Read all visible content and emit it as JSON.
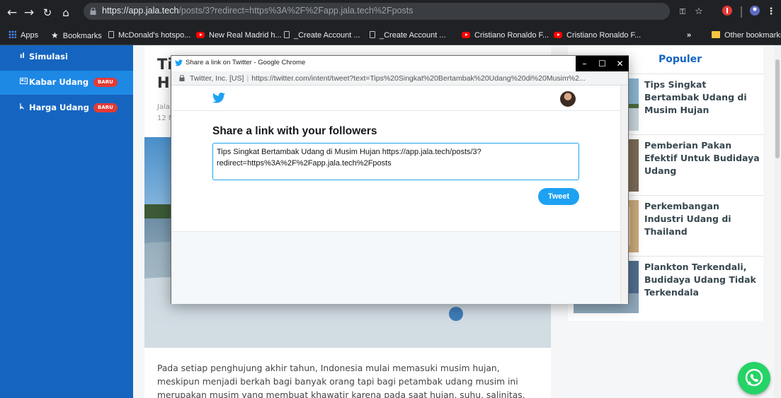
{
  "browser": {
    "url_host": "https://app.jala.tech",
    "url_path": "/posts/3?redirect=https%3A%2F%2Fapp.jala.tech%2Fposts",
    "bookmarks": [
      {
        "label": "Apps",
        "icon": "apps-icon"
      },
      {
        "label": "Bookmarks",
        "icon": "star-icon"
      },
      {
        "label": "McDonald's hotspo...",
        "icon": "page-icon"
      },
      {
        "label": "New Real Madrid h...",
        "icon": "youtube-icon"
      },
      {
        "label": "_Create Account ...",
        "icon": "page-icon"
      },
      {
        "label": "_Create Account ...",
        "icon": "page-icon"
      },
      {
        "label": "Cristiano Ronaldo F...",
        "icon": "youtube-icon"
      },
      {
        "label": "Cristiano Ronaldo F...",
        "icon": "youtube-icon"
      }
    ],
    "more_label": "»",
    "other_bookmarks": "Other bookmarks"
  },
  "sidebar": {
    "items": [
      {
        "label": "Simulasi",
        "icon": "chart-icon",
        "badge": "",
        "active": false
      },
      {
        "label": "Kabar Udang",
        "icon": "news-icon",
        "badge": "BARU",
        "active": true
      },
      {
        "label": "Harga Udang",
        "icon": "shrimp-icon",
        "badge": "BARU",
        "active": false
      }
    ]
  },
  "article": {
    "title_fragment": "Ti\nH",
    "meta_fragment": "Jala\n12 N",
    "body": "Pada setiap penghujung akhir tahun, Indonesia mulai memasuki musim hujan, meskipun menjadi berkah bagi banyak orang tapi bagi petambak udang musim ini merupakan musim yang membuat khawatir karena pada saat hujan, suhu, salinitas, pH dan oksigen terlarut (DO)"
  },
  "populer": {
    "heading": "Populer",
    "items": [
      {
        "title": "Tips Singkat Bertambak Udang di Musim Hujan"
      },
      {
        "title": "Pemberian Pakan Efektif Untuk Budidaya Udang"
      },
      {
        "title": "Perkembangan Industri Udang di Thailand"
      },
      {
        "title": "Plankton Terkendali, Budidaya Udang Tidak Terkendala"
      }
    ]
  },
  "popup": {
    "window_title": "Share a link on Twitter - Google Chrome",
    "site_identity": "Twitter, Inc. [US]",
    "url": "https://twitter.com/intent/tweet?text=Tips%20Singkat%20Bertambak%20Udang%20di%20Musim%2...",
    "heading": "Share a link with your followers",
    "tweet_text": "Tips Singkat Bertambak Udang di Musim Hujan https://app.jala.tech/posts/3?\nredirect=https%3A%2F%2Fapp.jala.tech%2Fposts",
    "tweet_button": "Tweet",
    "win_minimize": "–",
    "win_maximize": "☐",
    "win_close": "✕"
  },
  "colors": {
    "sidebar": "#1565c0",
    "sidebar_active": "#1e88e5",
    "badge": "#e53935",
    "twitter_blue": "#1da1f2",
    "whatsapp": "#25d366"
  }
}
